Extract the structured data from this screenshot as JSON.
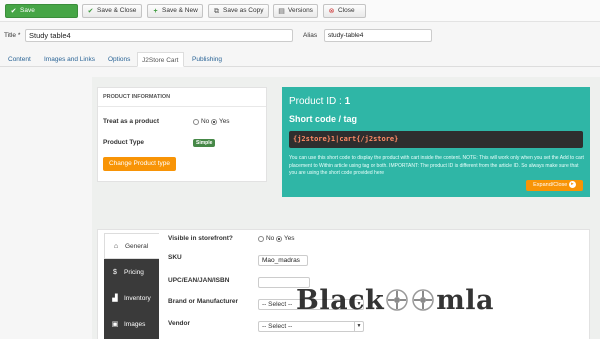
{
  "toolbar": {
    "save": "Save",
    "save_close": "Save & Close",
    "save_new": "Save & New",
    "save_copy": "Save as Copy",
    "versions": "Versions",
    "close": "Close"
  },
  "article": {
    "title_label": "Title *",
    "title_value": "Study table4",
    "alias_label": "Alias",
    "alias_value": "study-table4"
  },
  "tabs": [
    "Content",
    "Images and Links",
    "Options",
    "J2Store Cart",
    "Publishing"
  ],
  "active_tab": "J2Store Cart",
  "product_info": {
    "header": "PRODUCT INFORMATION",
    "treat_label": "Treat as a product",
    "treat_no": "No",
    "treat_yes": "Yes",
    "type_label": "Product Type",
    "type_value": "Simple",
    "change_button": "Change Product type"
  },
  "shortcode": {
    "id_label": "Product ID :",
    "id_value": "1",
    "title": "Short code / tag",
    "code": "{j2store}1|cart{/j2store}",
    "note": "You can use this short code to display the product with cart inside the content. NOTE: This will work only when you set the Add to cart placement to Within article using tag or both. IMPORTANT: The product ID is different from the article ID. So always make sure that you are using the short code provided here",
    "expand_button": "Expand/Close"
  },
  "side_tabs": [
    {
      "label": "General",
      "icon": "home-icon"
    },
    {
      "label": "Pricing",
      "icon": "dollar-icon"
    },
    {
      "label": "Inventory",
      "icon": "chart-icon"
    },
    {
      "label": "Images",
      "icon": "image-icon"
    }
  ],
  "general": {
    "visible_label": "Visible in storefront?",
    "visible_no": "No",
    "visible_yes": "Yes",
    "sku_label": "SKU",
    "sku_value": "Mao_madras",
    "upc_label": "UPC/EAN/JAN/ISBN",
    "upc_value": "",
    "brand_label": "Brand or Manufacturer",
    "brand_value": "-- Select --",
    "vendor_label": "Vendor",
    "vendor_value": "-- Select --"
  },
  "watermark": {
    "left": "Black",
    "right": "mla"
  },
  "colors": {
    "save_green": "#46a546",
    "teal": "#2fb6a6",
    "orange": "#f89406",
    "sidebar": "#3a3a3a"
  }
}
